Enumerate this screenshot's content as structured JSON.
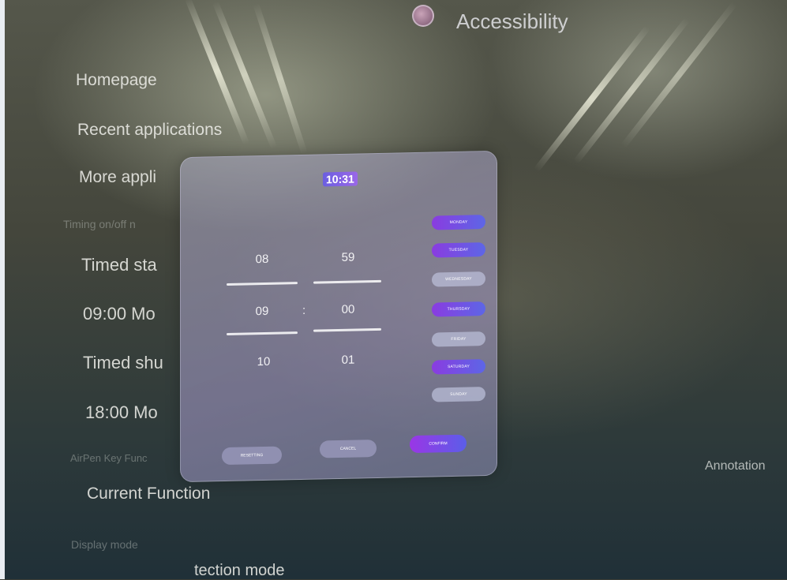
{
  "header": {
    "title": "Accessibility",
    "icon": "settings-app-icon"
  },
  "menu": {
    "items": [
      "Homepage",
      "Recent applications",
      "More appli"
    ]
  },
  "timing": {
    "section_label": "Timing on/off n",
    "startup_label": "Timed sta",
    "startup_value": "09:00  Mo",
    "shutdown_label": "Timed shu",
    "shutdown_value": "18:00  Mo"
  },
  "airpen": {
    "section_label": "AirPen Key Func",
    "current_function": "Current Function",
    "annotation": "Annotation"
  },
  "display": {
    "section_label": "Display mode",
    "mode_value": "tection mode"
  },
  "dialog": {
    "time": "10:31",
    "hours": [
      "08",
      "09",
      "10"
    ],
    "minutes": [
      "59",
      "00",
      "01"
    ],
    "separator": ":",
    "days": [
      {
        "label": "MONDAY",
        "selected": true
      },
      {
        "label": "TUESDAY",
        "selected": true
      },
      {
        "label": "WEDNESDAY",
        "selected": false
      },
      {
        "label": "THURSDAY",
        "selected": true
      },
      {
        "label": "FRIDAY",
        "selected": false
      },
      {
        "label": "SATURDAY",
        "selected": true
      },
      {
        "label": "SUNDAY",
        "selected": false
      }
    ],
    "buttons": {
      "reset": "RESETTING",
      "cancel": "CANCEL",
      "confirm": "CONFIRM"
    }
  },
  "colors": {
    "accent_start": "#8a3ce0",
    "accent_end": "#5d66e6",
    "day_off": "#b9bed7"
  }
}
